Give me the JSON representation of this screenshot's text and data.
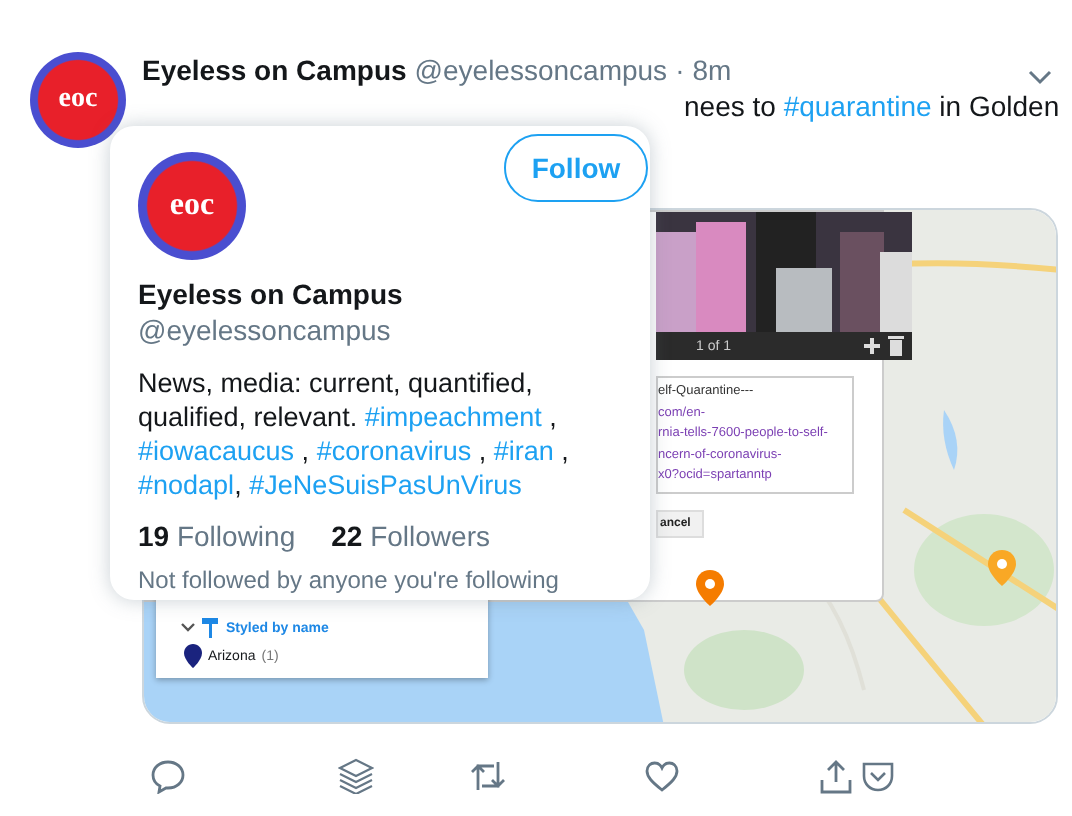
{
  "tweet": {
    "avatar_text": "eoc",
    "author": "Eyeless on Campus",
    "handle": "@eyelessoncampus",
    "separator": "·",
    "time": "8m",
    "text": [
      {
        "text": "nees to ",
        "kind": "plain"
      },
      {
        "text": "#quarantine",
        "kind": "hashtag"
      },
      {
        "text": " in Golden",
        "kind": "plain"
      }
    ]
  },
  "media": {
    "kind": "picture",
    "popup": {
      "counter": "1 of 1",
      "url_lines": [
        {
          "text": "elf-Quarantine---",
          "kind": "plain"
        },
        {
          "text": "com/en-",
          "kind": "link"
        },
        {
          "text": "rnia-tells-7600-people-to-self-",
          "kind": "link"
        },
        {
          "text": "ncern-of-coronavirus-",
          "kind": "link"
        },
        {
          "text": "x0?ocid=spartanntp",
          "kind": "link"
        }
      ],
      "cancel": "ancel"
    },
    "legend": {
      "style_label": "Styled by name",
      "expanded": true,
      "items": [
        {
          "name": "Arizona",
          "count": "(1)",
          "color": "#1a237e"
        }
      ]
    },
    "pins": [
      {
        "color": "#f57c00"
      },
      {
        "color": "#f9a825"
      }
    ]
  },
  "hover_card": {
    "avatar_text": "eoc",
    "name": "Eyeless on Campus",
    "handle": "@eyelessoncampus",
    "follow": "Follow",
    "bio": [
      {
        "text": "News, media: current, quantified, qualified, relevant. ",
        "kind": "plain"
      },
      {
        "text": "#impeachment",
        "kind": "hashtag"
      },
      {
        "text": " , ",
        "kind": "plain"
      },
      {
        "text": "#iowacaucus",
        "kind": "hashtag"
      },
      {
        "text": " , ",
        "kind": "plain"
      },
      {
        "text": "#coronavirus",
        "kind": "hashtag"
      },
      {
        "text": " , ",
        "kind": "plain"
      },
      {
        "text": "#iran",
        "kind": "hashtag"
      },
      {
        "text": " , ",
        "kind": "plain"
      },
      {
        "text": "#nodapl",
        "kind": "hashtag"
      },
      {
        "text": ", ",
        "kind": "plain"
      },
      {
        "text": "#JeNeSuisPasUnVirus",
        "kind": "hashtag"
      }
    ],
    "following_count": "19",
    "following_label": "Following",
    "followers_count": "22",
    "followers_label": "Followers",
    "note": "Not followed by anyone you're following"
  }
}
